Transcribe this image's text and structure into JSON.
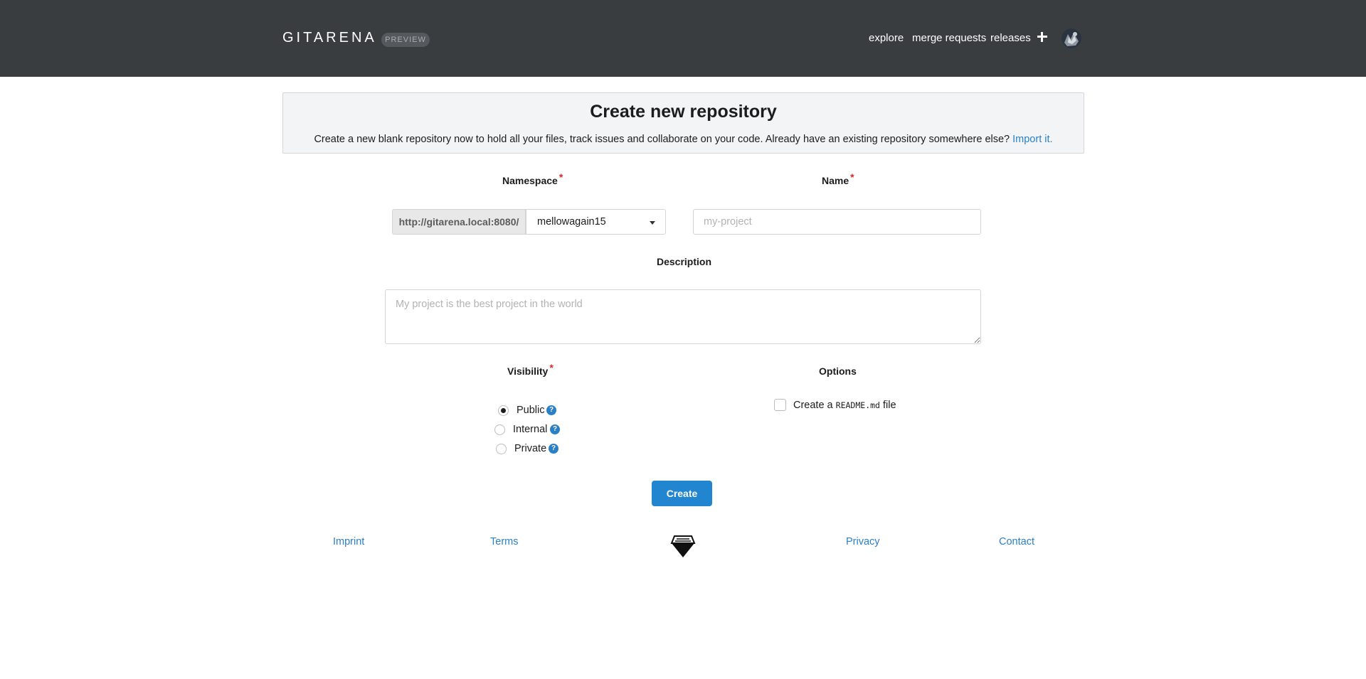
{
  "header": {
    "brand": "GITARENA",
    "badge": "PREVIEW",
    "nav": [
      "explore",
      "merge requests",
      "releases"
    ]
  },
  "intro": {
    "title": "Create new repository",
    "subtitle": "Create a new blank repository now to hold all your files, track issues and collaborate on your code. Already have an existing repository somewhere else?",
    "import_link": "Import it."
  },
  "form": {
    "namespace_label": "Namespace",
    "name_label": "Name",
    "required_mark": "*",
    "url_prefix": "http://gitarena.local:8080/",
    "namespace_value": "mellowagain15",
    "name_placeholder": "my-project",
    "description_label": "Description",
    "description_placeholder": "My project is the best project in the world",
    "visibility_label": "Visibility",
    "visibility_options": [
      {
        "label": "Public",
        "selected": true
      },
      {
        "label": "Internal",
        "selected": false
      },
      {
        "label": "Private",
        "selected": false
      }
    ],
    "help_glyph": "?",
    "options_label": "Options",
    "readme_prefix": "Create a",
    "readme_file": "README.md",
    "readme_suffix": "file",
    "create_button": "Create"
  },
  "footer": {
    "links": [
      "Imprint",
      "Terms",
      "Privacy",
      "Contact"
    ]
  },
  "colors": {
    "topbar": "#3a3d40",
    "primary": "#2185d0",
    "link": "#2b7fc5",
    "required": "#db2828"
  }
}
